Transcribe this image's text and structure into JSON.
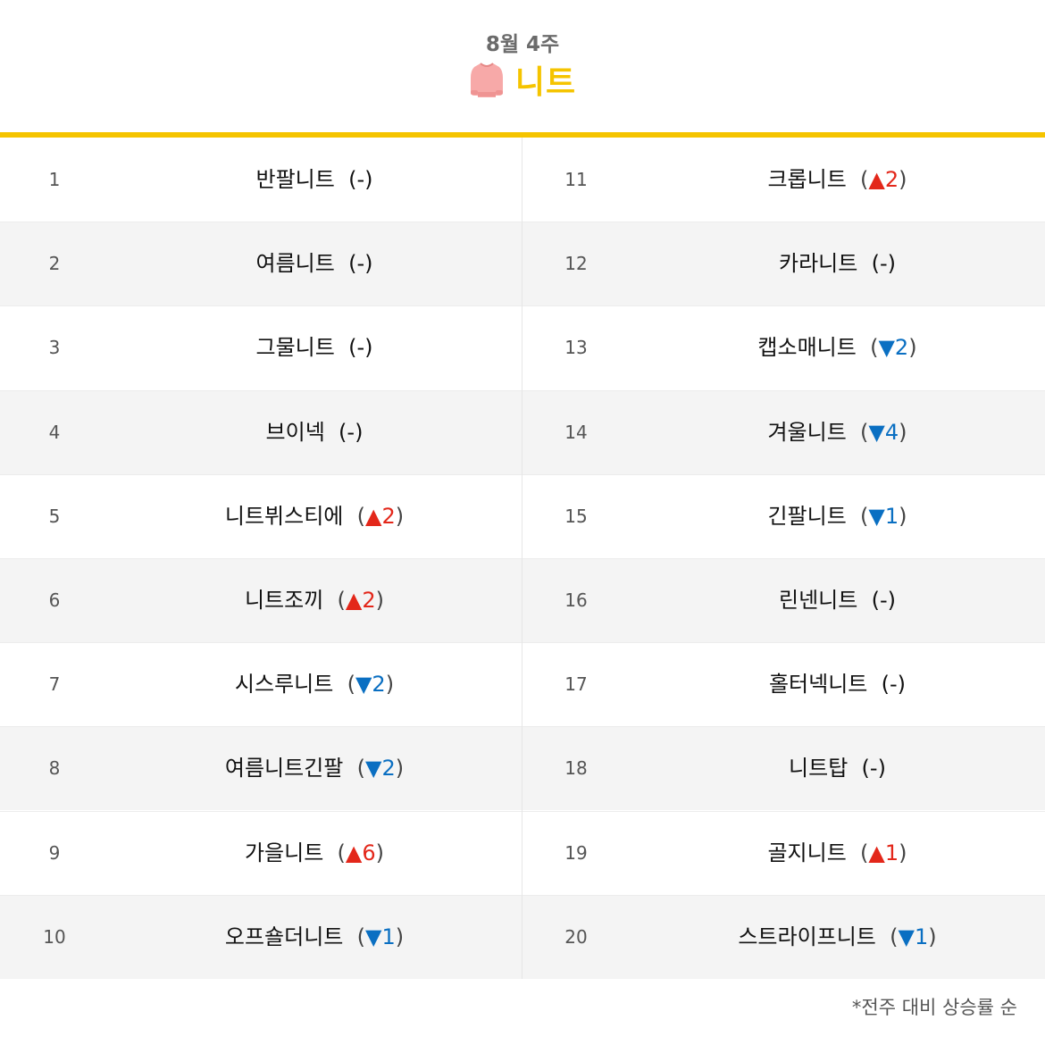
{
  "header": {
    "week": "8월 4주",
    "title": "니트",
    "icon": "sweater-icon",
    "accent_color": "#f5c400"
  },
  "left_column": [
    {
      "rank": "1",
      "keyword": "반팔니트",
      "change_dir": "none",
      "change_value": "-"
    },
    {
      "rank": "2",
      "keyword": "여름니트",
      "change_dir": "none",
      "change_value": "-"
    },
    {
      "rank": "3",
      "keyword": "그물니트",
      "change_dir": "none",
      "change_value": "-"
    },
    {
      "rank": "4",
      "keyword": "브이넥",
      "change_dir": "none",
      "change_value": "-"
    },
    {
      "rank": "5",
      "keyword": "니트뷔스티에",
      "change_dir": "up",
      "change_value": "2"
    },
    {
      "rank": "6",
      "keyword": "니트조끼",
      "change_dir": "up",
      "change_value": "2"
    },
    {
      "rank": "7",
      "keyword": "시스루니트",
      "change_dir": "down",
      "change_value": "2"
    },
    {
      "rank": "8",
      "keyword": "여름니트긴팔",
      "change_dir": "down",
      "change_value": "2"
    },
    {
      "rank": "9",
      "keyword": "가을니트",
      "change_dir": "up",
      "change_value": "6"
    },
    {
      "rank": "10",
      "keyword": "오프숄더니트",
      "change_dir": "down",
      "change_value": "1"
    }
  ],
  "right_column": [
    {
      "rank": "11",
      "keyword": "크롭니트",
      "change_dir": "up",
      "change_value": "2"
    },
    {
      "rank": "12",
      "keyword": "카라니트",
      "change_dir": "none",
      "change_value": "-"
    },
    {
      "rank": "13",
      "keyword": "캡소매니트",
      "change_dir": "down",
      "change_value": "2"
    },
    {
      "rank": "14",
      "keyword": "겨울니트",
      "change_dir": "down",
      "change_value": "4"
    },
    {
      "rank": "15",
      "keyword": "긴팔니트",
      "change_dir": "down",
      "change_value": "1"
    },
    {
      "rank": "16",
      "keyword": "린넨니트",
      "change_dir": "none",
      "change_value": "-"
    },
    {
      "rank": "17",
      "keyword": "홀터넥니트",
      "change_dir": "none",
      "change_value": "-"
    },
    {
      "rank": "18",
      "keyword": "니트탑",
      "change_dir": "none",
      "change_value": "-"
    },
    {
      "rank": "19",
      "keyword": "골지니트",
      "change_dir": "up",
      "change_value": "1"
    },
    {
      "rank": "20",
      "keyword": "스트라이프니트",
      "change_dir": "down",
      "change_value": "1"
    }
  ],
  "symbols": {
    "up": "▲",
    "down": "▼",
    "open": "(",
    "close": ")"
  },
  "colors": {
    "up": "#e3271a",
    "down": "#0a6fc2",
    "row_alt": "#f4f4f4"
  },
  "footnote": "*전주 대비 상승률 순"
}
